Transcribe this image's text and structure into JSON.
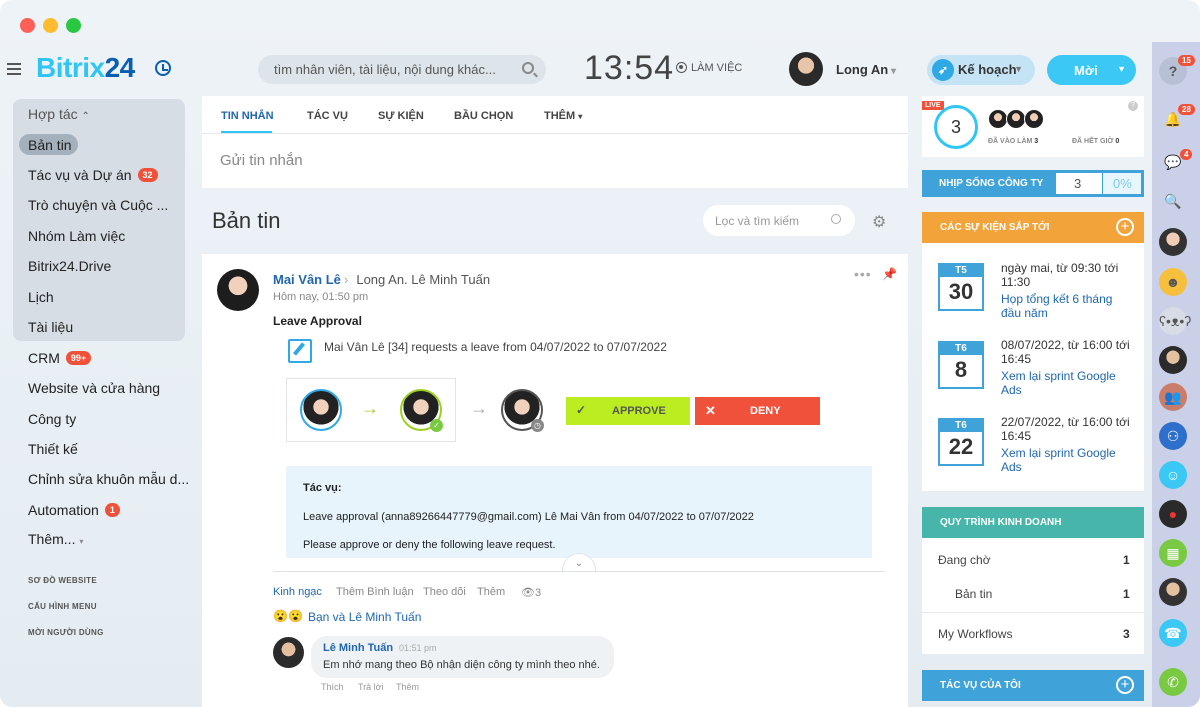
{
  "header": {
    "logo_main": "Bitrix",
    "logo_num": "24",
    "search_placeholder": "tìm nhân viên, tài liệu, nội dung khác...",
    "time": "13:54",
    "work_status": "LÀM VIỆC",
    "user_name": "Long An",
    "plan_label": "Kế hoạch",
    "new_label": "Mời"
  },
  "sidebar": {
    "group_label": "Hợp tác",
    "items": [
      {
        "label": "Bản tin"
      },
      {
        "label": "Tác vụ và Dự án",
        "badge": "32"
      },
      {
        "label": "Trò chuyện và Cuộc ..."
      },
      {
        "label": "Nhóm Làm việc"
      },
      {
        "label": "Bitrix24.Drive"
      },
      {
        "label": "Lịch"
      },
      {
        "label": "Tài liệu"
      },
      {
        "label": "CRM",
        "badge": "99+"
      },
      {
        "label": "Website và cửa hàng"
      },
      {
        "label": "Công ty"
      },
      {
        "label": "Thiết kế"
      },
      {
        "label": "Chỉnh sửa khuôn mẫu d..."
      },
      {
        "label": "Automation",
        "badge": "1"
      },
      {
        "label": "Thêm..."
      }
    ],
    "small_links": [
      "SƠ ĐỒ WEBSITE",
      "CẤU HÌNH MENU",
      "MỜI NGƯỜI DÙNG"
    ]
  },
  "tabs": [
    "TIN NHẮN",
    "TÁC VỤ",
    "SỰ KIỆN",
    "BẦU CHỌN",
    "THÊM"
  ],
  "composer_placeholder": "Gửi tin nhắn",
  "page_title": "Bản tin",
  "filter_placeholder": "Lọc và tìm kiếm",
  "post": {
    "author": "Mai Vân Lê",
    "recipients": "Long An. Lê Minh Tuấn",
    "time": "Hôm nay, 01:50 pm",
    "type": "Leave Approval",
    "request": "Mai Vân Lê [34] requests a leave from 04/07/2022 to 07/07/2022",
    "approve": "APPROVE",
    "deny": "DENY",
    "task_title": "Tác vụ:",
    "task_line1": "Leave approval (anna89266447779@gmail.com) Lê Mai Vân from 04/07/2022 to 07/07/2022",
    "task_line2": "Please approve or deny the following leave request.",
    "actions": [
      "Kinh ngạc",
      "Thêm Bình luận",
      "Theo dõi",
      "Thêm"
    ],
    "views": "3",
    "reactions": "Bạn và Lê Minh Tuấn"
  },
  "comment": {
    "author": "Lê Minh Tuấn",
    "time": "01:51 pm",
    "text": "Em nhớ mang theo Bộ nhận diện công ty mình theo nhé.",
    "actions": [
      "Thích",
      "Trả lời",
      "Thêm"
    ]
  },
  "right": {
    "live": "LIVE",
    "count": "3",
    "joined_label": "ĐÃ VÀO LÀM",
    "joined_count": "3",
    "ended_label": "ĐÃ HẾT GIỜ",
    "ended_count": "0",
    "pulse_label": "NHỊP SỐNG CÔNG TY",
    "pulse_value": "3",
    "pulse_percent": "0%",
    "events_header": "CÁC SỰ KIỆN SẮP TỚI",
    "events": [
      {
        "dow": "T5",
        "day": "30",
        "date1": "ngày mai, từ 09:30 tới",
        "date2": "11:30",
        "title1": "Họp tổng kết 6 tháng",
        "title2": "đầu năm"
      },
      {
        "dow": "T6",
        "day": "8",
        "date1": "08/07/2022, từ 16:00 tới",
        "date2": "16:45",
        "title1": "Xem lại sprint Google",
        "title2": "Ads"
      },
      {
        "dow": "T6",
        "day": "22",
        "date1": "22/07/2022, từ 16:00 tới",
        "date2": "16:45",
        "title1": "Xem lại sprint Google",
        "title2": "Ads"
      }
    ],
    "process_header": "QUY TRÌNH KINH DOANH",
    "process": [
      {
        "label": "Đang chờ",
        "count": "1"
      },
      {
        "label": "Bản tin",
        "count": "1"
      },
      {
        "label": "My Workflows",
        "count": "3"
      }
    ],
    "tasks_header": "TÁC VỤ CỦA TÔI"
  },
  "rail_badges": [
    "15",
    "28",
    "4"
  ],
  "colors": {
    "accent": "#2fc6f6",
    "brand_dark": "#0a5eb0",
    "badge": "#f0513a",
    "approve": "#bbed21",
    "events": "#f2a43a",
    "process": "#47b5a9"
  }
}
